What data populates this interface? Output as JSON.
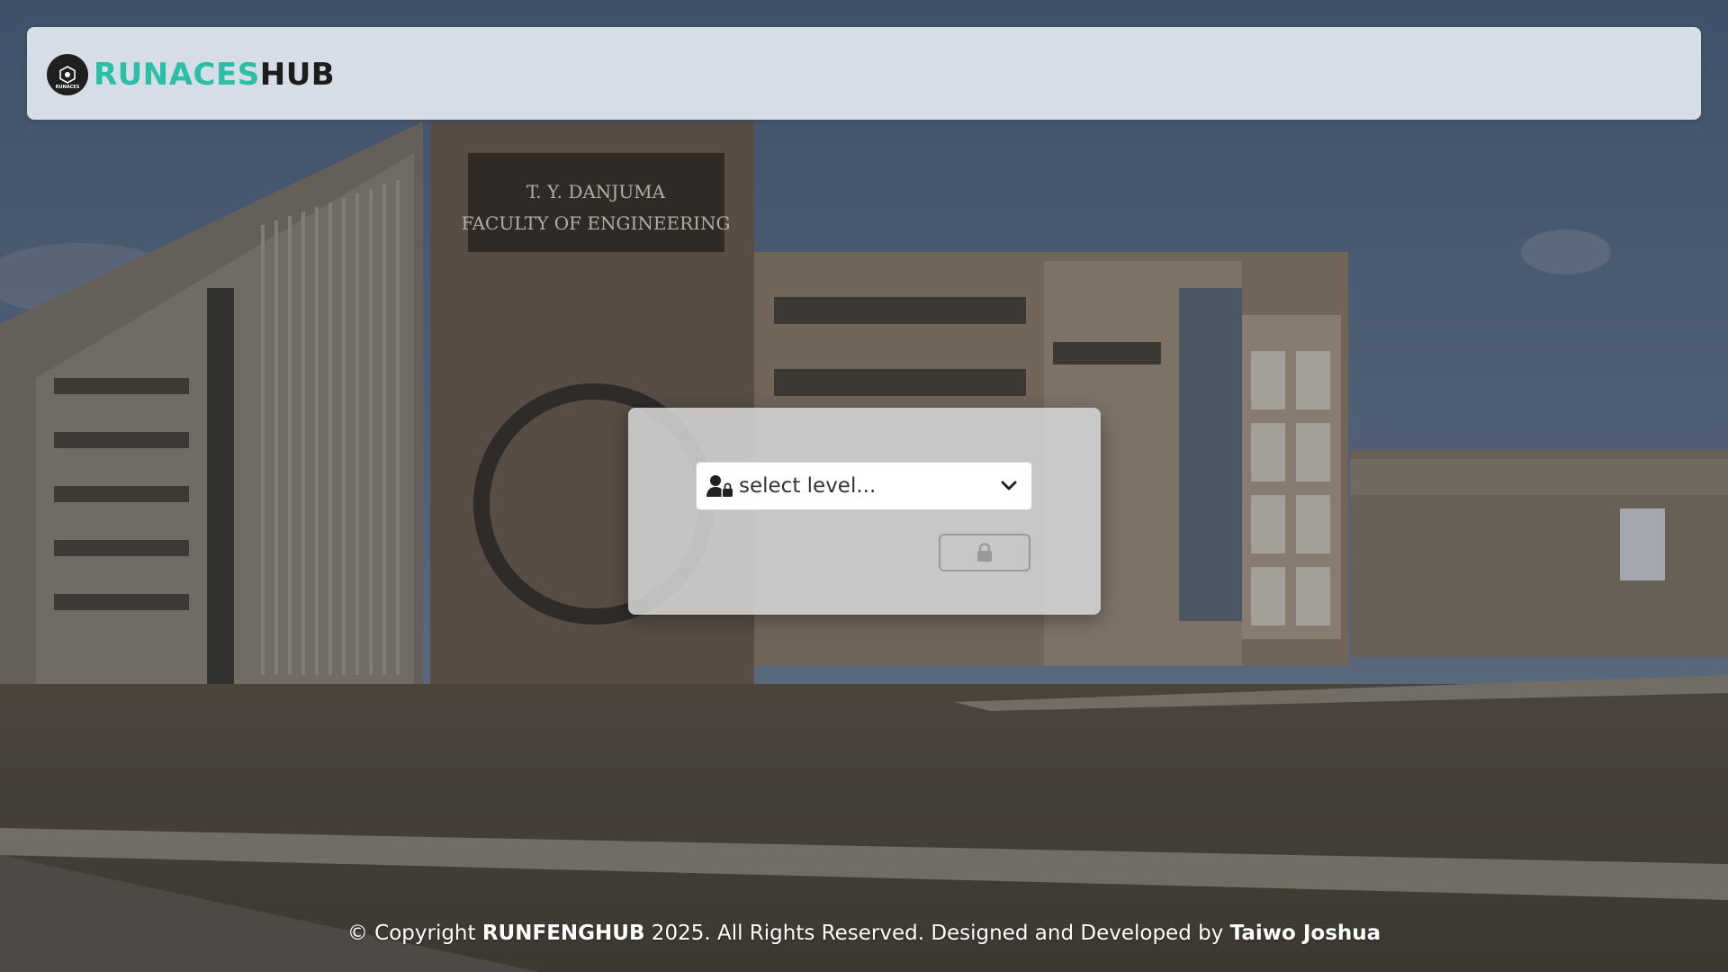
{
  "brand": {
    "name_accent": "RUNACES",
    "name_dark": "HUB",
    "logo_text": "RUNACES",
    "accent_color": "#2bbfa6"
  },
  "building": {
    "signage_line1": "T. Y. DANJUMA",
    "signage_line2": "FACULTY OF ENGINEERING"
  },
  "login": {
    "level_select": {
      "placeholder": "select level...",
      "icon": "user-lock-icon",
      "dropdown_icon": "chevron-down-icon"
    },
    "submit_icon": "lock-icon"
  },
  "footer": {
    "prefix": "© Copyright ",
    "brand": "RUNFENGHUB",
    "middle": " 2025. All Rights Reserved. Designed and Developed by ",
    "author": "Taiwo Joshua"
  }
}
